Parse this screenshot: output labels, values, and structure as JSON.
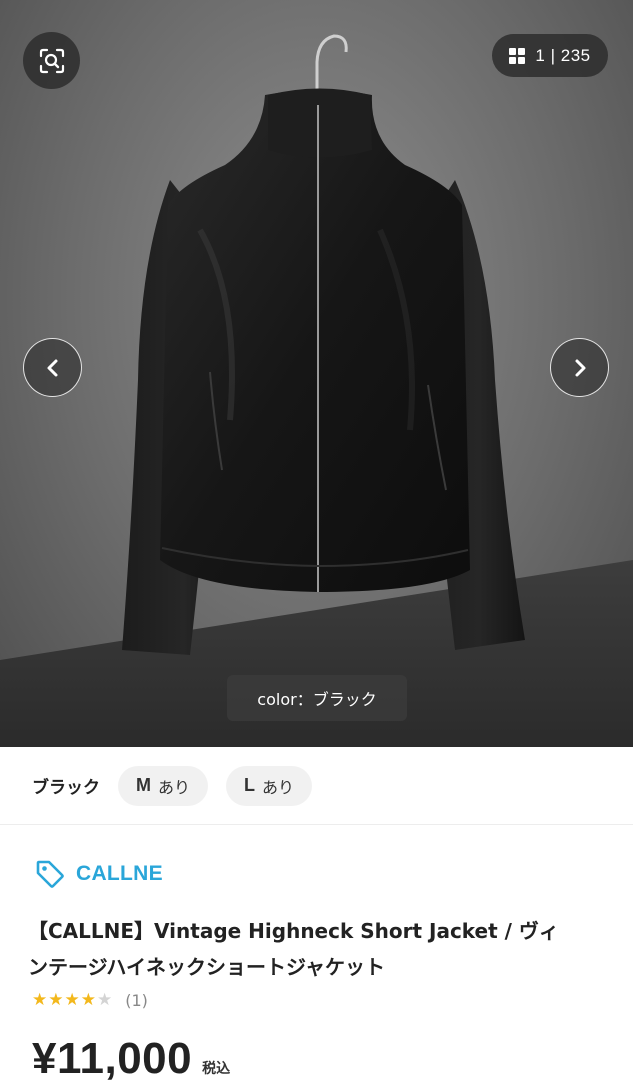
{
  "gallery": {
    "current": "1",
    "separator": "|",
    "total": "235",
    "caption": "color：ブラック",
    "icons": {
      "lens": "image-search-icon",
      "grid": "grid-icon",
      "prev": "chevron-left-icon",
      "next": "chevron-right-icon"
    }
  },
  "variants": {
    "color_label": "ブラック",
    "sizes": [
      {
        "size": "M",
        "status": "あり"
      },
      {
        "size": "L",
        "status": "あり"
      }
    ]
  },
  "product": {
    "brand": "CALLNE",
    "brand_icon": "tag-icon",
    "brand_color": "#2aa6d9",
    "title_line1": "【CALLNE】Vintage Highneck Short Jacket / ヴィ",
    "title_line2": "ンテージハイネックショートジャケット",
    "rating_value": 4,
    "rating_max": 5,
    "review_count": "(1)",
    "star_color": "#f3b81c",
    "price": "¥11,000",
    "tax_label": "税込"
  }
}
